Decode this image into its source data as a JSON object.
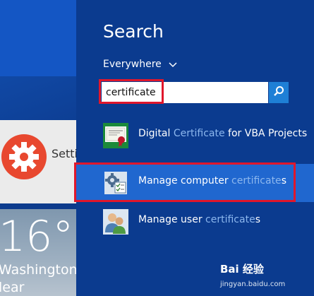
{
  "start": {
    "settings_label": "Setti",
    "weather_temp": "16°",
    "weather_city": "Washington",
    "weather_condition": "lear"
  },
  "search_panel": {
    "title": "Search",
    "scope_label": "Everywhere",
    "query": "certificate"
  },
  "results": [
    {
      "pre": "Digital ",
      "match": "Certificate",
      "post": " for VBA Projects"
    },
    {
      "pre": "Manage computer ",
      "match": "certificate",
      "post": "s"
    },
    {
      "pre": "Manage user ",
      "match": "certificate",
      "post": "s"
    }
  ],
  "watermark": {
    "brand": "Bai 经验",
    "url": "jingyan.baidu.com"
  },
  "colors": {
    "highlight": "#e0172c",
    "selected_row": "#2067cf",
    "panel_bg": "#0b3b8f"
  }
}
